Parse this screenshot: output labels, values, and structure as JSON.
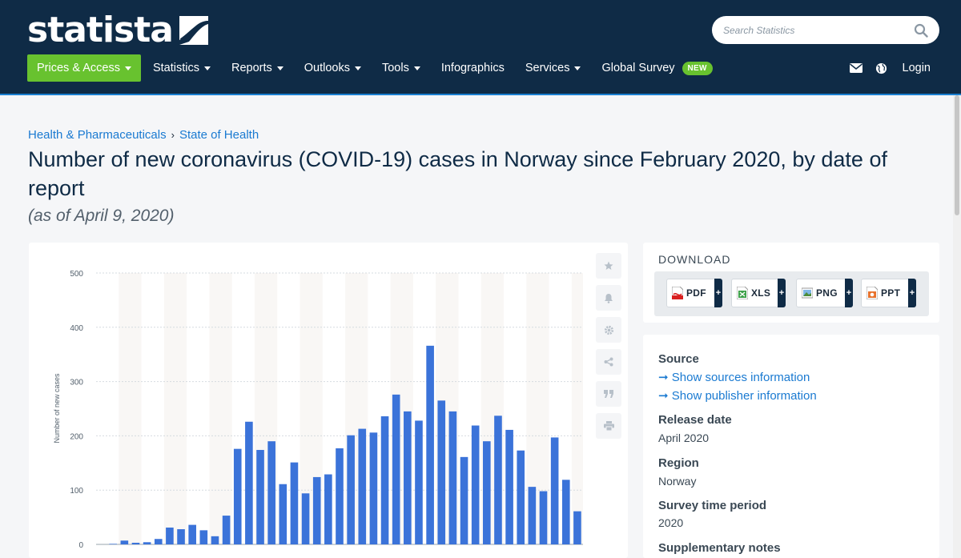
{
  "header": {
    "logo_text": "statista",
    "search_placeholder": "Search Statistics",
    "nav": [
      {
        "label": "Prices & Access",
        "dropdown": true
      },
      {
        "label": "Statistics",
        "dropdown": true
      },
      {
        "label": "Reports",
        "dropdown": true
      },
      {
        "label": "Outlooks",
        "dropdown": true
      },
      {
        "label": "Tools",
        "dropdown": true
      },
      {
        "label": "Infographics",
        "dropdown": false
      },
      {
        "label": "Services",
        "dropdown": true
      },
      {
        "label": "Global Survey",
        "dropdown": false,
        "badge": "NEW"
      }
    ],
    "login": "Login"
  },
  "breadcrumb": [
    "Health & Pharmaceuticals",
    "State of Health"
  ],
  "page": {
    "title": "Number of new coronavirus (COVID-19) cases in Norway since February 2020, by date of report",
    "subtitle": "(as of April 9, 2020)"
  },
  "download": {
    "title": "DOWNLOAD",
    "formats": [
      "PDF",
      "XLS",
      "PNG",
      "PPT"
    ],
    "plus": "+"
  },
  "info": {
    "source_heading": "Source",
    "source_link": "Show sources information",
    "publisher_link": "Show publisher information",
    "release_heading": "Release date",
    "release_value": "April 2020",
    "region_heading": "Region",
    "region_value": "Norway",
    "period_heading": "Survey time period",
    "period_value": "2020",
    "notes_heading": "Supplementary notes"
  },
  "colors": {
    "header_bg": "#0f2b46",
    "accent_green": "#68c22f",
    "link_blue": "#1a7ad1",
    "bar_blue": "#3b73d9"
  },
  "chart_data": {
    "type": "bar",
    "ylabel": "Number of new cases",
    "ylim": [
      0,
      500
    ],
    "yticks": [
      0,
      100,
      200,
      300,
      400,
      500
    ],
    "grid": true,
    "values": [
      0,
      1,
      7,
      3,
      4,
      10,
      31,
      28,
      36,
      26,
      15,
      53,
      176,
      226,
      174,
      190,
      111,
      151,
      94,
      124,
      129,
      177,
      201,
      213,
      206,
      236,
      276,
      245,
      228,
      366,
      265,
      245,
      161,
      219,
      190,
      237,
      211,
      173,
      106,
      98,
      197,
      119,
      61
    ]
  }
}
